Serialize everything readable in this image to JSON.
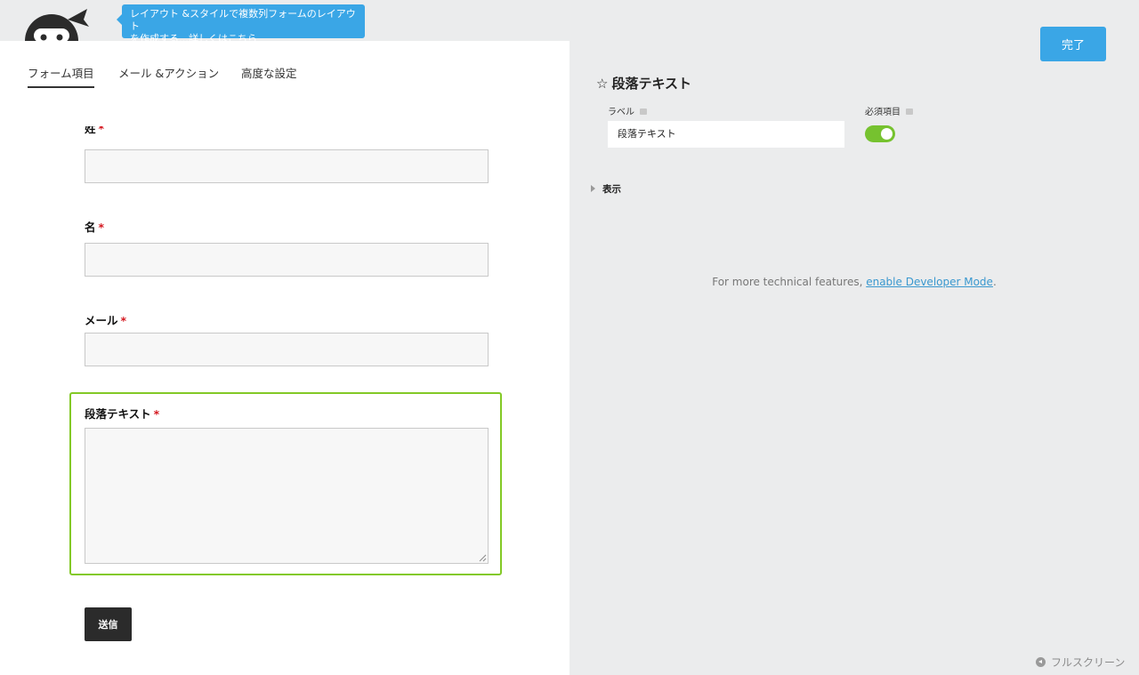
{
  "tooltip": {
    "line1": "レイアウト &スタイルで複数列フォームのレイアウト",
    "line2": "を作成する…詳しくはこちら"
  },
  "tabs": [
    {
      "label": "フォーム項目",
      "active": true
    },
    {
      "label": "メール &アクション",
      "active": false
    },
    {
      "label": "高度な設定",
      "active": false
    }
  ],
  "form": {
    "fields": [
      {
        "label": "姓",
        "required": true,
        "type": "textbox"
      },
      {
        "label": "名",
        "required": true,
        "type": "textbox"
      },
      {
        "label": "メール",
        "required": true,
        "type": "email"
      },
      {
        "label": "段落テキスト",
        "required": true,
        "type": "textarea",
        "selected": true
      }
    ],
    "required_mark": "*",
    "submit_label": "送信"
  },
  "header": {
    "done_label": "完了"
  },
  "settings": {
    "title": "段落テキスト",
    "label_caption": "ラベル",
    "label_value": "段落テキスト",
    "required_caption": "必須項目",
    "required_on": true,
    "display_section": "表示",
    "dev_note_prefix": "For more technical features, ",
    "dev_note_link": "enable Developer Mode",
    "dev_note_suffix": "."
  },
  "footer": {
    "fullscreen_label": "フルスクリーン"
  },
  "colors": {
    "accent_blue": "#3aa6e6",
    "selected_green": "#83c926",
    "toggle_green": "#76c22f",
    "required_red": "#d4171f"
  }
}
